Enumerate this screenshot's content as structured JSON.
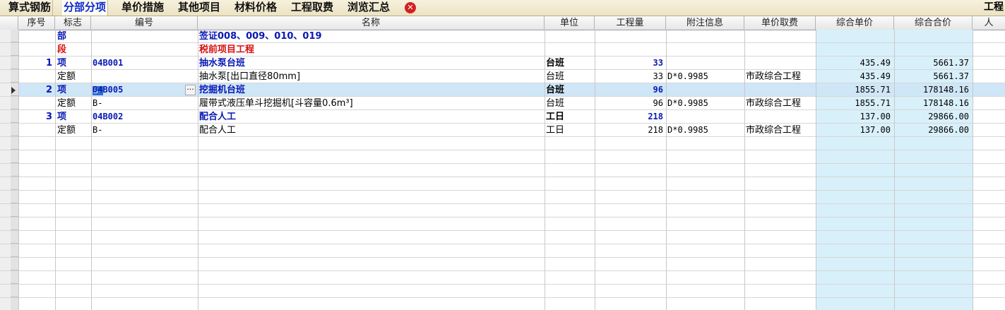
{
  "tabs": [
    {
      "label": "算式钢筋"
    },
    {
      "label": "分部分项"
    },
    {
      "label": "单价措施"
    },
    {
      "label": "其他项目"
    },
    {
      "label": "材料价格"
    },
    {
      "label": "工程取费"
    },
    {
      "label": "浏览汇总"
    }
  ],
  "right_label": "工程",
  "columns": [
    "序号",
    "标志",
    "编号",
    "名称",
    "单位",
    "工程量",
    "附注信息",
    "单价取费",
    "综合单价",
    "综合合价",
    "人"
  ],
  "rows": [
    {
      "seq": "",
      "flag": "部",
      "code": "",
      "name": "签证008、009、010、019",
      "unit": "",
      "qty": "",
      "note": "",
      "fee": "",
      "price": "",
      "total": ""
    },
    {
      "seq": "",
      "flag": "段",
      "code": "",
      "name": "税前项目工程",
      "unit": "",
      "qty": "",
      "note": "",
      "fee": "",
      "price": "",
      "total": ""
    },
    {
      "seq": "1",
      "flag": "项",
      "code": "04B001",
      "name": "抽水泵台班",
      "unit": "台班",
      "qty": "33",
      "note": "",
      "fee": "",
      "price": "435.49",
      "total": "5661.37"
    },
    {
      "seq": "",
      "flag": "定额",
      "code": "B-",
      "name": "抽水泵[出口直径80mm]",
      "unit": "台班",
      "qty": "33",
      "note": "D*0.9985",
      "fee": "市政综合工程",
      "price": "435.49",
      "total": "5661.37"
    },
    {
      "seq": "2",
      "flag": "项",
      "code": "04B005",
      "name": "挖掘机台班",
      "unit": "台班",
      "qty": "96",
      "note": "",
      "fee": "",
      "price": "1855.71",
      "total": "178148.16"
    },
    {
      "seq": "",
      "flag": "定额",
      "code": "B-",
      "name": "履带式液压单斗挖掘机[斗容量0.6m³]",
      "unit": "台班",
      "qty": "96",
      "note": "D*0.9985",
      "fee": "市政综合工程",
      "price": "1855.71",
      "total": "178148.16"
    },
    {
      "seq": "3",
      "flag": "项",
      "code": "04B002",
      "name": "配合人工",
      "unit": "工日",
      "qty": "218",
      "note": "",
      "fee": "",
      "price": "137.00",
      "total": "29866.00"
    },
    {
      "seq": "",
      "flag": "定额",
      "code": "B-",
      "name": "配合人工",
      "unit": "工日",
      "qty": "218",
      "note": "D*0.9985",
      "fee": "市政综合工程",
      "price": "137.00",
      "total": "29866.00"
    }
  ],
  "editor": {
    "value": "B-",
    "button": "···"
  },
  "colors": {
    "accent": "#0a2ad0",
    "subtotal_blue": "#0818b4",
    "section_red": "#d81010",
    "price_column_bg": "#d8f0fa"
  }
}
